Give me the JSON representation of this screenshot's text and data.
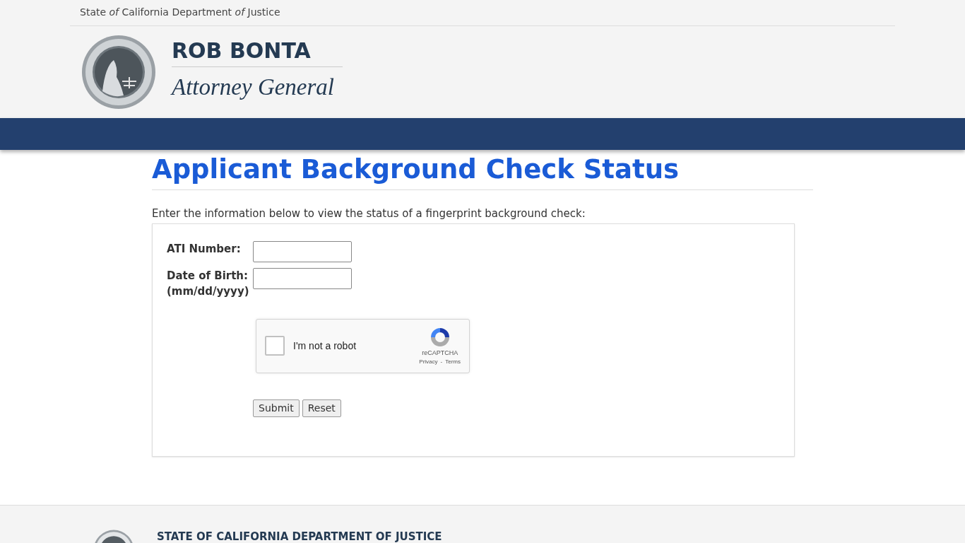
{
  "agency_bar": {
    "text": "State *of* California Department *of* Justice"
  },
  "brand": {
    "name": "ROB BONTA",
    "title": "Attorney General"
  },
  "page": {
    "heading": "Applicant Background Check Status",
    "intro": "Enter the information below to view the status of a fingerprint background check:"
  },
  "form": {
    "fields": [
      {
        "label": "ATI Number:"
      },
      {
        "label": "Date of Birth:",
        "hint": "(mm/dd/yyyy)"
      }
    ],
    "captcha": {
      "label": "I'm not a robot",
      "checked": false,
      "brand": "reCAPTCHA",
      "links": [
        "Privacy",
        "Terms"
      ],
      "separator": "-"
    },
    "buttons": [
      "Submit",
      "Reset"
    ]
  },
  "footer": {
    "title": "STATE OF CALIFORNIA DEPARTMENT OF JUSTICE"
  }
}
